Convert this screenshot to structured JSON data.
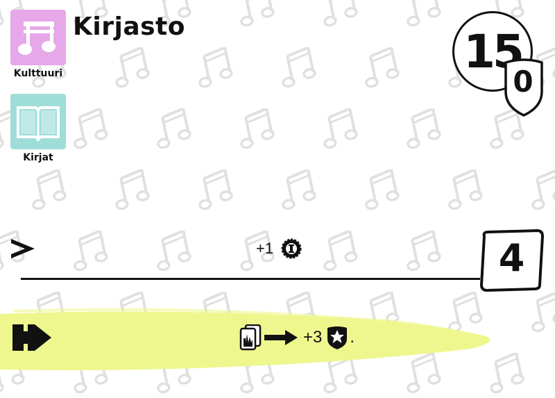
{
  "card": {
    "title": "Kirjasto",
    "cost": "15",
    "shield_value": "0",
    "victory_points": "4"
  },
  "tags": [
    {
      "label": "Kulttuuri",
      "icon": "music-note-icon",
      "color": "#e6a8e8"
    },
    {
      "label": "Kirjat",
      "icon": "open-book-icon",
      "color": "#9fded8"
    }
  ],
  "production": {
    "text": "+1",
    "icon": "coin-icon"
  },
  "effect": {
    "text": "+3",
    "trailing": ".",
    "icons": [
      "card-deck-icon",
      "arrow-right-icon",
      "star-shield-icon"
    ],
    "highlight_color": "#eef78e"
  },
  "watermark_icon": "music-note-icon"
}
